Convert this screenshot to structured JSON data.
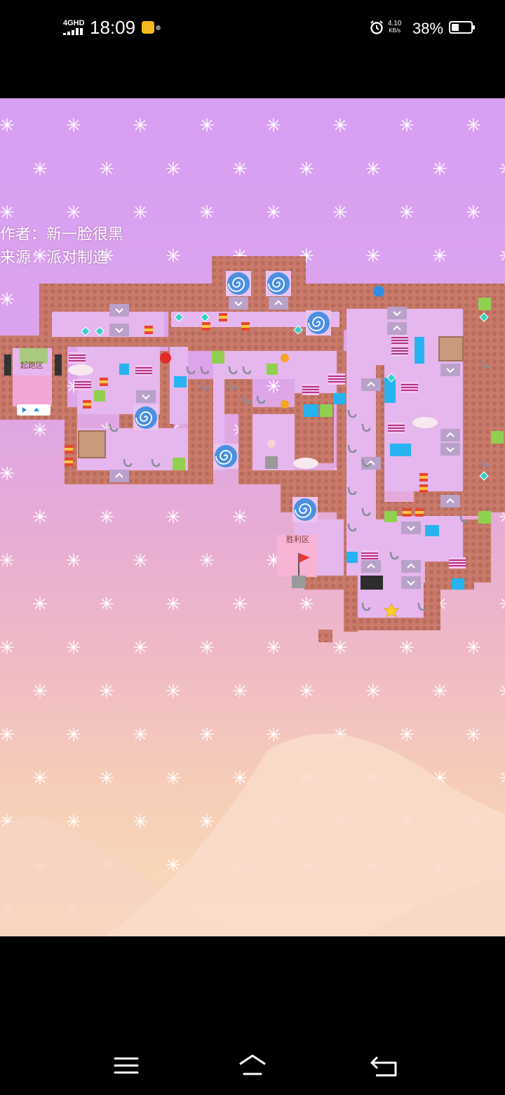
{
  "status_bar": {
    "network": "4GHD",
    "time": "18:09",
    "net_speed_value": "4.10",
    "net_speed_unit": "KB/s",
    "battery_percent": "38%",
    "battery_level": 0.38,
    "icons": [
      "signal-icon",
      "app-notification-icon",
      "alarm-icon",
      "battery-icon"
    ]
  },
  "game": {
    "credits": {
      "author": "作者：新一脸很黑",
      "source": "来源：派对制造"
    },
    "zones": {
      "start": "起跑区",
      "victory": "胜利区"
    },
    "colors": {
      "sky_top": "#d89ef3",
      "sky_bottom": "#f9dcb8",
      "brick": "#c97a6a",
      "floor": "#e6b6ee",
      "portal": "#4c8fe0",
      "ice": "#27b3f0",
      "slime": "#8fd14f",
      "spring": "#b83280"
    }
  },
  "nav_bar": {
    "icons": [
      "menu-icon",
      "home-icon",
      "back-icon"
    ]
  }
}
